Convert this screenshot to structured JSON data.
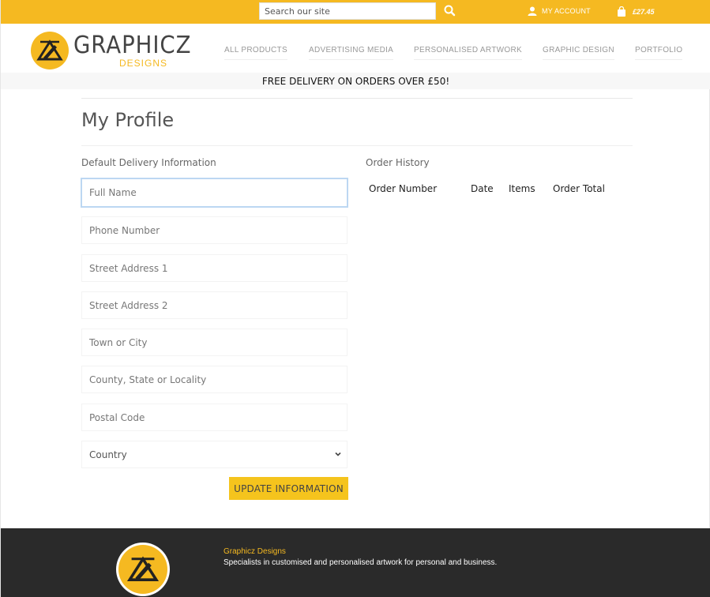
{
  "topbar": {
    "search_placeholder": "Search our site",
    "account_label": "MY ACCOUNT",
    "cart_total": "£27.45"
  },
  "brand": {
    "name": "GRAPHICZ",
    "sub": "DESIGNS"
  },
  "nav": {
    "items": [
      "ALL PRODUCTS",
      "ADVERTISING MEDIA",
      "PERSONALISED ARTWORK",
      "GRAPHIC DESIGN",
      "PORTFOLIO"
    ]
  },
  "banner": "FREE DELIVERY ON ORDERS OVER £50!",
  "page_title": "My Profile",
  "delivery": {
    "heading": "Default Delivery Information",
    "fields": [
      {
        "placeholder": "Full Name"
      },
      {
        "placeholder": "Phone Number"
      },
      {
        "placeholder": "Street Address 1"
      },
      {
        "placeholder": "Street Address 2"
      },
      {
        "placeholder": "Town or City"
      },
      {
        "placeholder": "County, State or Locality"
      },
      {
        "placeholder": "Postal Code"
      }
    ],
    "country_label": "Country",
    "update_button": "UPDATE INFORMATION"
  },
  "orders": {
    "heading": "Order History",
    "columns": [
      "Order Number",
      "Date",
      "Items",
      "Order Total"
    ]
  },
  "footer": {
    "title": "Graphicz Designs",
    "tagline": "Specialists in customised and personalised artwork for personal and business."
  },
  "colors": {
    "accent": "#f5b921",
    "button": "#f5c41d",
    "footer_bg": "#2a2a2a"
  }
}
